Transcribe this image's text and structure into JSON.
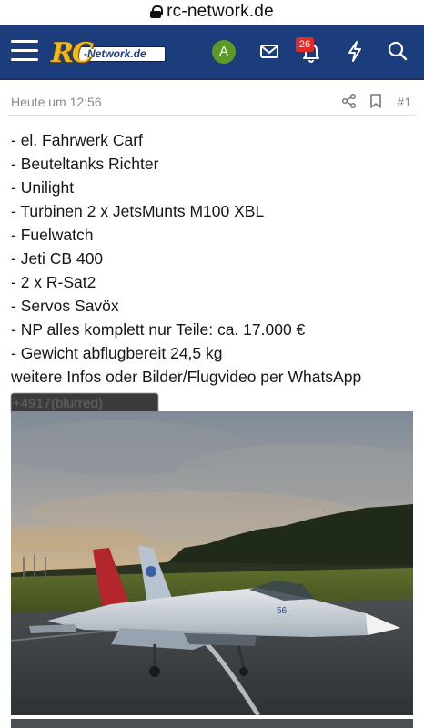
{
  "browser": {
    "domain": "rc-network.de"
  },
  "header": {
    "logo_text": "RC-Network.de",
    "avatar_letter": "A",
    "notification_count": "26",
    "icons": [
      "menu-icon",
      "mail-icon",
      "bell-icon",
      "bolt-icon",
      "search-icon"
    ],
    "color": "#1c3d7c"
  },
  "post": {
    "timestamp": "Heute um 12:56",
    "number": "#1",
    "lines": [
      "- el. Fahrwerk Carf",
      "- Beuteltanks Richter",
      "- Unilight",
      "- Turbinen 2 x JetsMunts M100 XBL",
      "- Fuelwatch",
      "- Jeti CB 400",
      "- 2 x R-Sat2",
      "- Servos Savöx",
      "- NP alles komplett nur Teile: ca. 17.000 €",
      "- Gewicht abflugbereit 24,5 kg",
      "weitere Infos oder Bilder/Flugvideo per WhatsApp"
    ],
    "phone_redacted": "+4917(blurred)"
  }
}
